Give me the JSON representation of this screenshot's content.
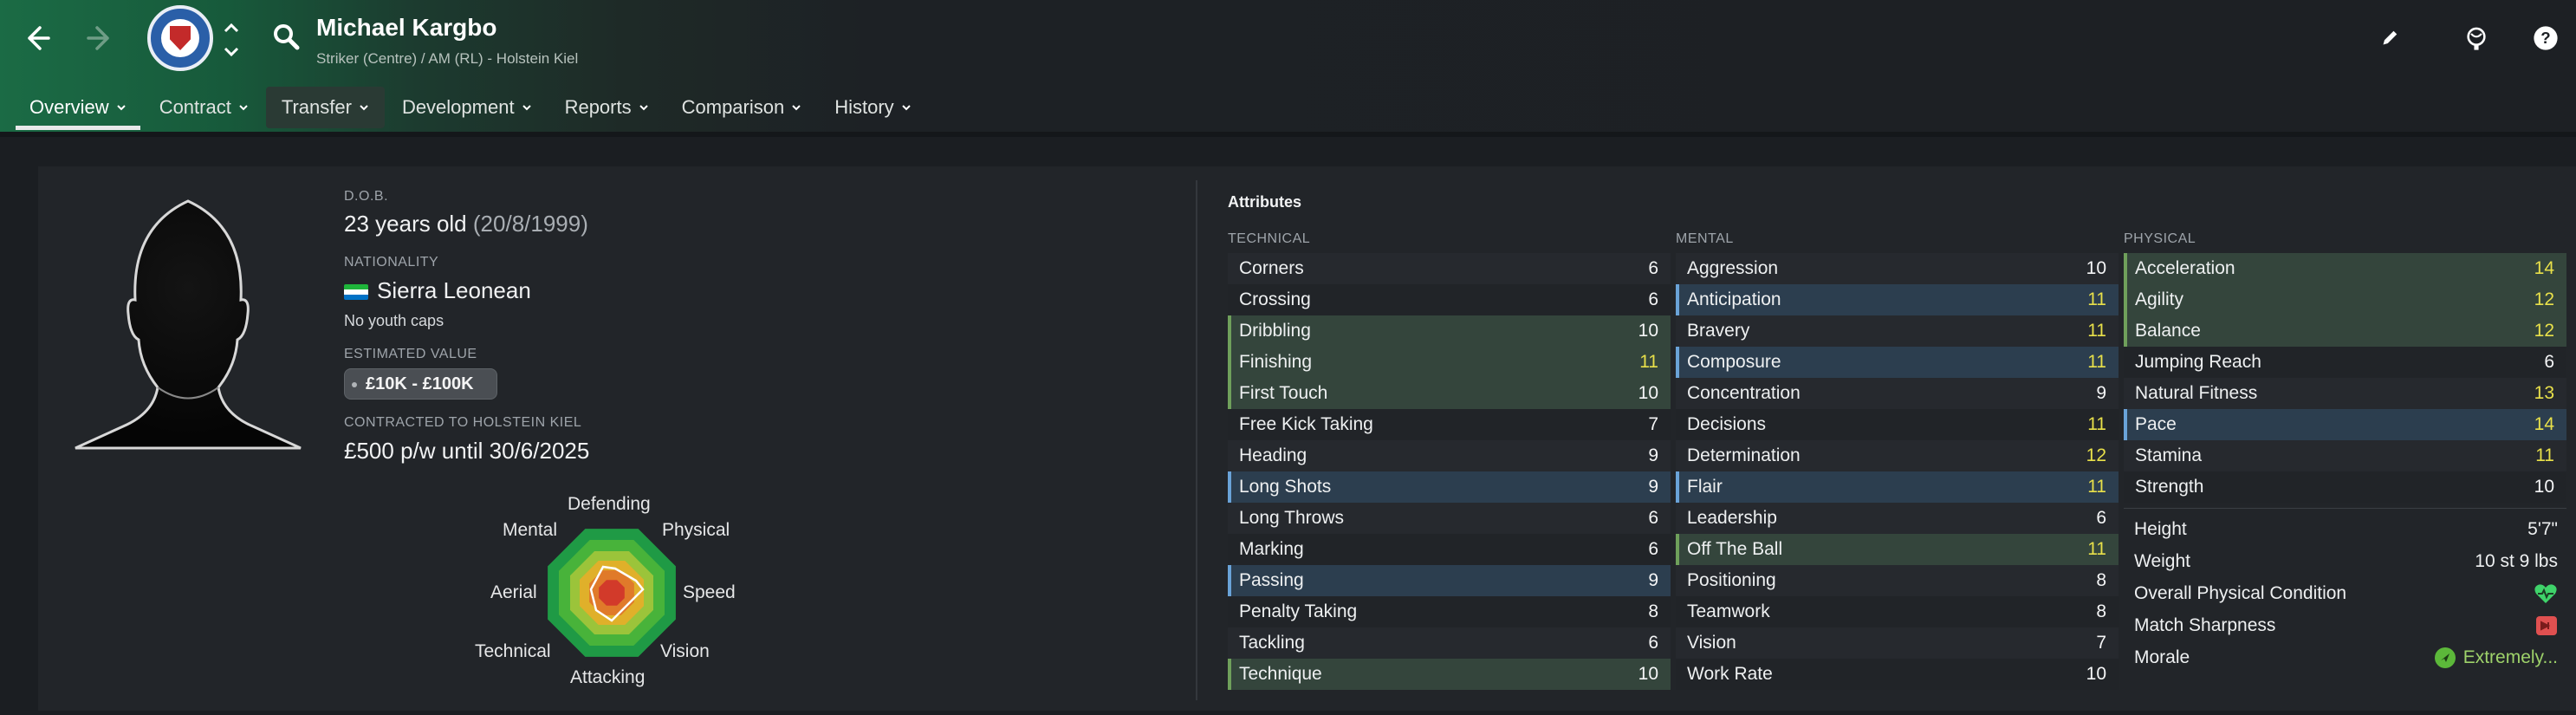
{
  "header": {
    "player_name": "Michael Kargbo",
    "player_sub": "Striker (Centre) / AM (RL) - Holstein Kiel",
    "icons": [
      "back-arrow-icon",
      "forward-arrow-icon",
      "club-crest-icon",
      "up-down-icon",
      "search-icon",
      "edit-pencil-icon",
      "scout-globe-icon",
      "help-icon"
    ]
  },
  "tabs": [
    {
      "label": "Overview"
    },
    {
      "label": "Contract"
    },
    {
      "label": "Transfer"
    },
    {
      "label": "Development"
    },
    {
      "label": "Reports"
    },
    {
      "label": "Comparison"
    },
    {
      "label": "History"
    }
  ],
  "profile": {
    "dob_label": "D.O.B.",
    "age": "23 years old",
    "dob": "(20/8/1999)",
    "nationality_label": "NATIONALITY",
    "nationality": "Sierra Leonean",
    "youth_caps": "No youth caps",
    "value_label": "ESTIMATED VALUE",
    "value": "£10K - £100K",
    "contract_label": "CONTRACTED TO HOLSTEIN KIEL",
    "contract": "£500 p/w until 30/6/2025"
  },
  "radar": {
    "labels": {
      "defending": "Defending",
      "physical": "Physical",
      "speed": "Speed",
      "vision": "Vision",
      "attacking": "Attacking",
      "technical": "Technical",
      "aerial": "Aerial",
      "mental": "Mental"
    },
    "colors": [
      "#1f9a45",
      "#48b33a",
      "#9bc43a",
      "#e0b02a",
      "#e07a2a",
      "#d23a2a"
    ]
  },
  "attributes": {
    "title": "Attributes",
    "technical_label": "TECHNICAL",
    "mental_label": "MENTAL",
    "physical_label": "PHYSICAL",
    "technical": [
      {
        "name": "Corners",
        "value": "6",
        "hl": ""
      },
      {
        "name": "Crossing",
        "value": "6",
        "hl": ""
      },
      {
        "name": "Dribbling",
        "value": "10",
        "hl": "green"
      },
      {
        "name": "Finishing",
        "value": "11",
        "hl": "green"
      },
      {
        "name": "First Touch",
        "value": "10",
        "hl": "green"
      },
      {
        "name": "Free Kick Taking",
        "value": "7",
        "hl": ""
      },
      {
        "name": "Heading",
        "value": "9",
        "hl": ""
      },
      {
        "name": "Long Shots",
        "value": "9",
        "hl": "blue"
      },
      {
        "name": "Long Throws",
        "value": "6",
        "hl": ""
      },
      {
        "name": "Marking",
        "value": "6",
        "hl": ""
      },
      {
        "name": "Passing",
        "value": "9",
        "hl": "blue"
      },
      {
        "name": "Penalty Taking",
        "value": "8",
        "hl": ""
      },
      {
        "name": "Tackling",
        "value": "6",
        "hl": ""
      },
      {
        "name": "Technique",
        "value": "10",
        "hl": "green"
      }
    ],
    "mental": [
      {
        "name": "Aggression",
        "value": "10",
        "hl": ""
      },
      {
        "name": "Anticipation",
        "value": "11",
        "hl": "blue"
      },
      {
        "name": "Bravery",
        "value": "11",
        "hl": ""
      },
      {
        "name": "Composure",
        "value": "11",
        "hl": "blue"
      },
      {
        "name": "Concentration",
        "value": "9",
        "hl": ""
      },
      {
        "name": "Decisions",
        "value": "11",
        "hl": ""
      },
      {
        "name": "Determination",
        "value": "12",
        "hl": ""
      },
      {
        "name": "Flair",
        "value": "11",
        "hl": "blue"
      },
      {
        "name": "Leadership",
        "value": "6",
        "hl": ""
      },
      {
        "name": "Off The Ball",
        "value": "11",
        "hl": "green"
      },
      {
        "name": "Positioning",
        "value": "8",
        "hl": ""
      },
      {
        "name": "Teamwork",
        "value": "8",
        "hl": ""
      },
      {
        "name": "Vision",
        "value": "7",
        "hl": ""
      },
      {
        "name": "Work Rate",
        "value": "10",
        "hl": ""
      }
    ],
    "physical": [
      {
        "name": "Acceleration",
        "value": "14",
        "hl": "green"
      },
      {
        "name": "Agility",
        "value": "12",
        "hl": "green"
      },
      {
        "name": "Balance",
        "value": "12",
        "hl": "green"
      },
      {
        "name": "Jumping Reach",
        "value": "6",
        "hl": ""
      },
      {
        "name": "Natural Fitness",
        "value": "13",
        "hl": ""
      },
      {
        "name": "Pace",
        "value": "14",
        "hl": "blue"
      },
      {
        "name": "Stamina",
        "value": "11",
        "hl": ""
      },
      {
        "name": "Strength",
        "value": "10",
        "hl": ""
      }
    ],
    "physical_extra": {
      "height_label": "Height",
      "height": "5'7\"",
      "weight_label": "Weight",
      "weight": "10 st 9 lbs",
      "condition_label": "Overall Physical Condition",
      "sharpness_label": "Match Sharpness",
      "morale_label": "Morale",
      "morale": "Extremely..."
    }
  },
  "colors": {
    "highlight_value": "#e8e04a",
    "green_bar": "#6fa05b",
    "blue_bar": "#6aa3d8"
  }
}
